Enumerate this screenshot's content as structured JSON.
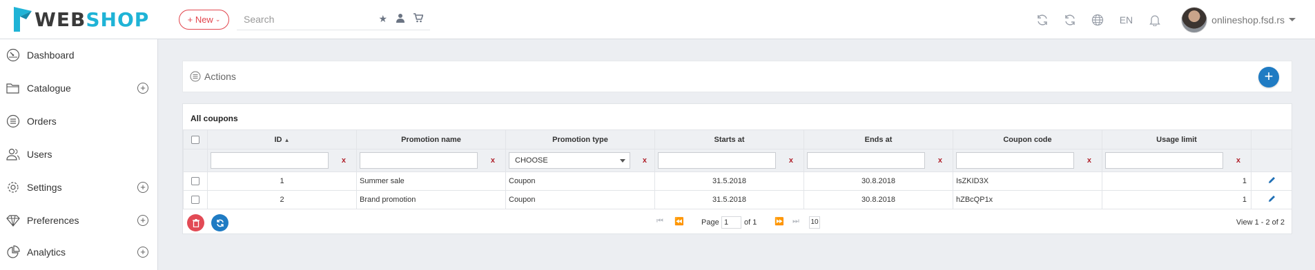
{
  "header": {
    "logo_part1": "WEB",
    "logo_part2": "SHOP",
    "new_label": "+ New",
    "search_placeholder": "Search",
    "language": "EN",
    "user_name": "onlineshop.fsd.rs"
  },
  "sidebar": {
    "items": [
      {
        "label": "Dashboard",
        "icon": "dashboard-icon",
        "expandable": false
      },
      {
        "label": "Catalogue",
        "icon": "folder-icon",
        "expandable": true
      },
      {
        "label": "Orders",
        "icon": "list-icon",
        "expandable": false
      },
      {
        "label": "Users",
        "icon": "users-icon",
        "expandable": false
      },
      {
        "label": "Settings",
        "icon": "gear-icon",
        "expandable": true
      },
      {
        "label": "Preferences",
        "icon": "diamond-icon",
        "expandable": true
      },
      {
        "label": "Analytics",
        "icon": "pie-chart-icon",
        "expandable": true
      }
    ]
  },
  "actions": {
    "title": "Actions"
  },
  "grid": {
    "title": "All coupons",
    "columns": [
      "ID",
      "Promotion name",
      "Promotion type",
      "Starts at",
      "Ends at",
      "Coupon code",
      "Usage limit"
    ],
    "filter_clear": "x",
    "type_filter_value": "CHOOSE",
    "rows": [
      {
        "id": "1",
        "name": "Summer sale",
        "type": "Coupon",
        "starts": "31.5.2018",
        "ends": "30.8.2018",
        "code": "IsZKID3X",
        "limit": "1"
      },
      {
        "id": "2",
        "name": "Brand promotion",
        "type": "Coupon",
        "starts": "31.5.2018",
        "ends": "30.8.2018",
        "code": "hZBcQP1x",
        "limit": "1"
      }
    ],
    "pager": {
      "page_label": "Page",
      "page_value": "1",
      "of_label": "of 1",
      "rows_per_page": "10",
      "view_text": "View 1 - 2 of 2"
    }
  },
  "colors": {
    "brand_dark": "#3a3a3a",
    "brand_accent": "#1fb3d6",
    "danger": "#e24a55",
    "primary": "#1f7bc3"
  }
}
